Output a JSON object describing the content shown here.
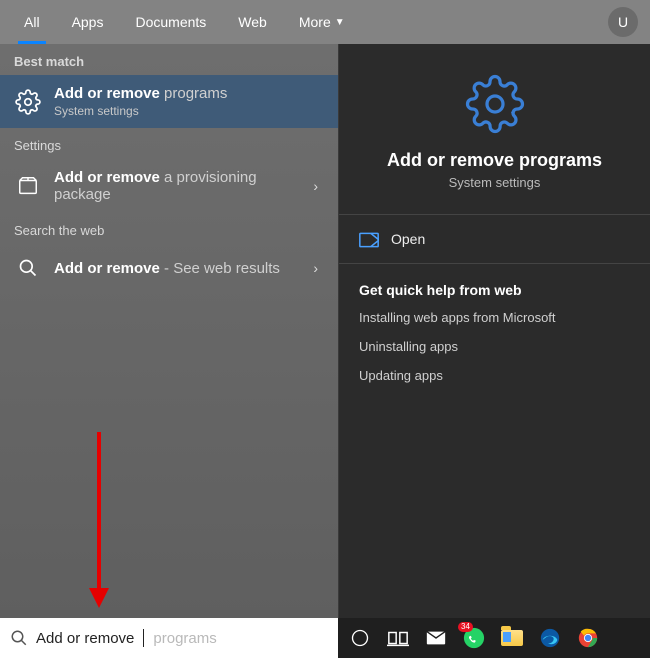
{
  "tabs": {
    "all": "All",
    "apps": "Apps",
    "documents": "Documents",
    "web": "Web",
    "more": "More"
  },
  "avatar_initial": "U",
  "sections": {
    "best_match": "Best match",
    "settings": "Settings",
    "search_web": "Search the web"
  },
  "results": {
    "best": {
      "title_strong": "Add or remove",
      "title_rest": " programs",
      "sub": "System settings"
    },
    "settings_item": {
      "title_strong": "Add or remove",
      "title_rest": " a provisioning package"
    },
    "web_item": {
      "title_strong": "Add or remove",
      "title_rest": " - See web results"
    }
  },
  "preview": {
    "title": "Add or remove programs",
    "sub": "System settings",
    "open": "Open",
    "help_title": "Get quick help from web",
    "help_links": {
      "a": "Installing web apps from Microsoft",
      "b": "Uninstalling apps",
      "c": "Updating apps"
    }
  },
  "search": {
    "typed": "Add or remove ",
    "ghost": "programs"
  },
  "taskbar_badge": "34"
}
